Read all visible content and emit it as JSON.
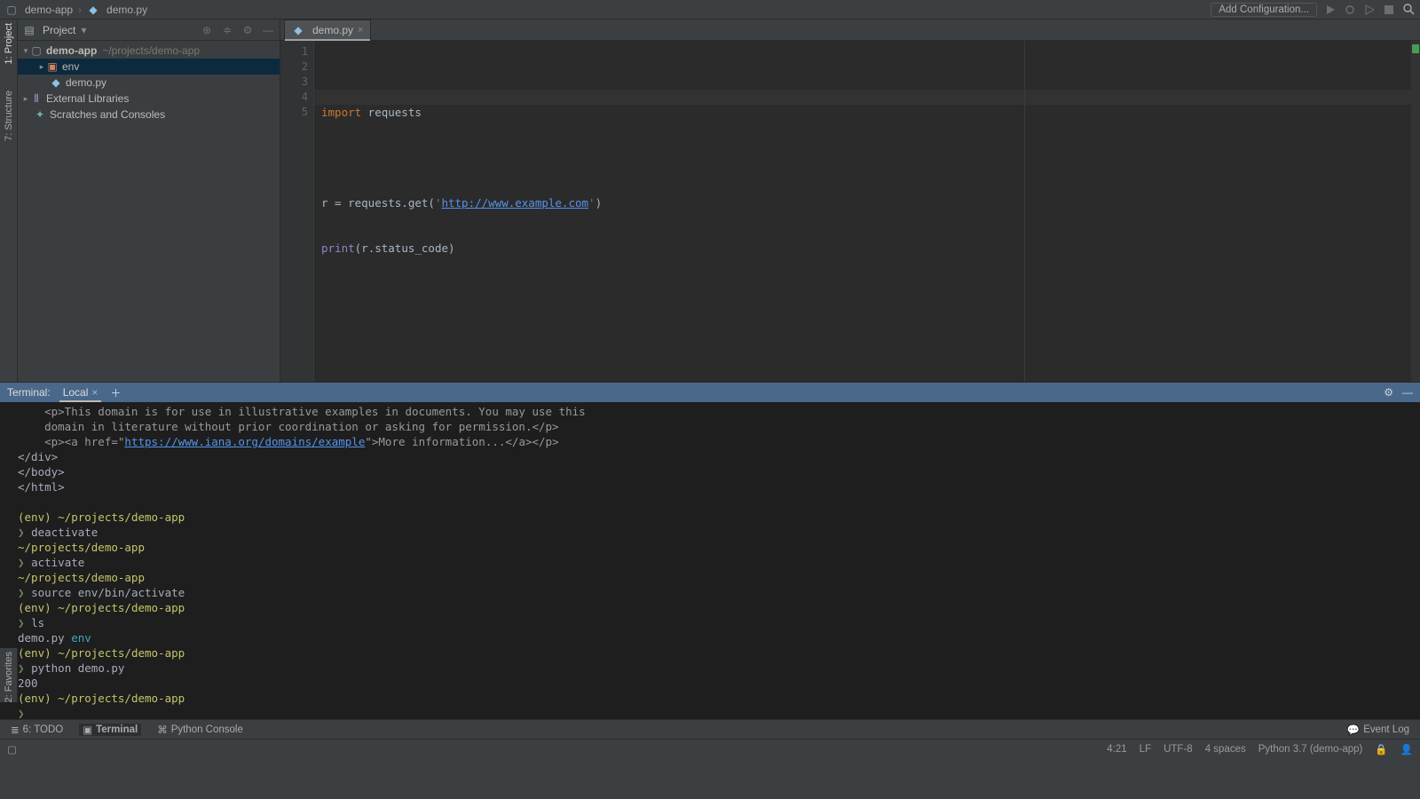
{
  "breadcrumb": {
    "project": "demo-app",
    "file": "demo.py"
  },
  "navbar": {
    "add_config": "Add Configuration..."
  },
  "left_strip": {
    "project": "1: Project",
    "structure": "7: Structure",
    "favorites": "2: Favorites"
  },
  "project_panel": {
    "title": "Project",
    "root": {
      "name": "demo-app",
      "path": "~/projects/demo-app"
    },
    "tree": {
      "env": "env",
      "demo": "demo.py",
      "external": "External Libraries",
      "scratch": "Scratches and Consoles"
    }
  },
  "editor": {
    "tab": {
      "label": "demo.py"
    },
    "gutter": [
      "1",
      "2",
      "3",
      "4",
      "5"
    ],
    "code": {
      "l1_kw": "import",
      "l1_id": " requests",
      "l3_a": "r = requests.get(",
      "l3_q": "'",
      "l3_url": "http://www.example.com",
      "l3_b": ")",
      "l4_fn": "print",
      "l4_a": "(",
      "l4_b": "r.status_code",
      "l4_c": ")"
    }
  },
  "terminal": {
    "header": {
      "label": "Terminal:",
      "tab": "Local"
    },
    "lines": [
      {
        "type": "cmt",
        "text": "    <p>This domain is for use in illustrative examples in documents. You may use this"
      },
      {
        "type": "cmt",
        "text": "    domain in literature without prior coordination or asking for permission.</p>"
      },
      {
        "type": "mixed",
        "prefix": "    <p><a href=\"",
        "link": "https://www.iana.org/domains/example",
        "suffix": "\">More information...</a></p>"
      },
      {
        "type": "plain",
        "text": "</div>"
      },
      {
        "type": "plain",
        "text": "</body>"
      },
      {
        "type": "plain",
        "text": "</html>"
      },
      {
        "type": "blank",
        "text": ""
      },
      {
        "type": "envpath",
        "env": "(env) ",
        "path": "~/projects/demo-app"
      },
      {
        "type": "cmd",
        "text": "deactivate"
      },
      {
        "type": "path",
        "text": "~/projects/demo-app"
      },
      {
        "type": "cmd",
        "text": "activate"
      },
      {
        "type": "path",
        "text": "~/projects/demo-app"
      },
      {
        "type": "cmd",
        "text": "source env/bin/activate"
      },
      {
        "type": "envpath",
        "env": "(env) ",
        "path": "~/projects/demo-app"
      },
      {
        "type": "cmd",
        "text": "ls"
      },
      {
        "type": "ls",
        "a": "demo.py ",
        "b": "env"
      },
      {
        "type": "envpath",
        "env": "(env) ",
        "path": "~/projects/demo-app"
      },
      {
        "type": "cmd",
        "text": "python demo.py"
      },
      {
        "type": "plain",
        "text": "200"
      },
      {
        "type": "envpath",
        "env": "(env) ",
        "path": "~/projects/demo-app"
      },
      {
        "type": "cmd",
        "text": ""
      }
    ]
  },
  "bottom_tools": {
    "todo": "6: TODO",
    "terminal": "Terminal",
    "python": "Python Console",
    "eventlog": "Event Log"
  },
  "status": {
    "pos": "4:21",
    "eol": "LF",
    "enc": "UTF-8",
    "indent": "4 spaces",
    "interp": "Python 3.7 (demo-app)"
  }
}
